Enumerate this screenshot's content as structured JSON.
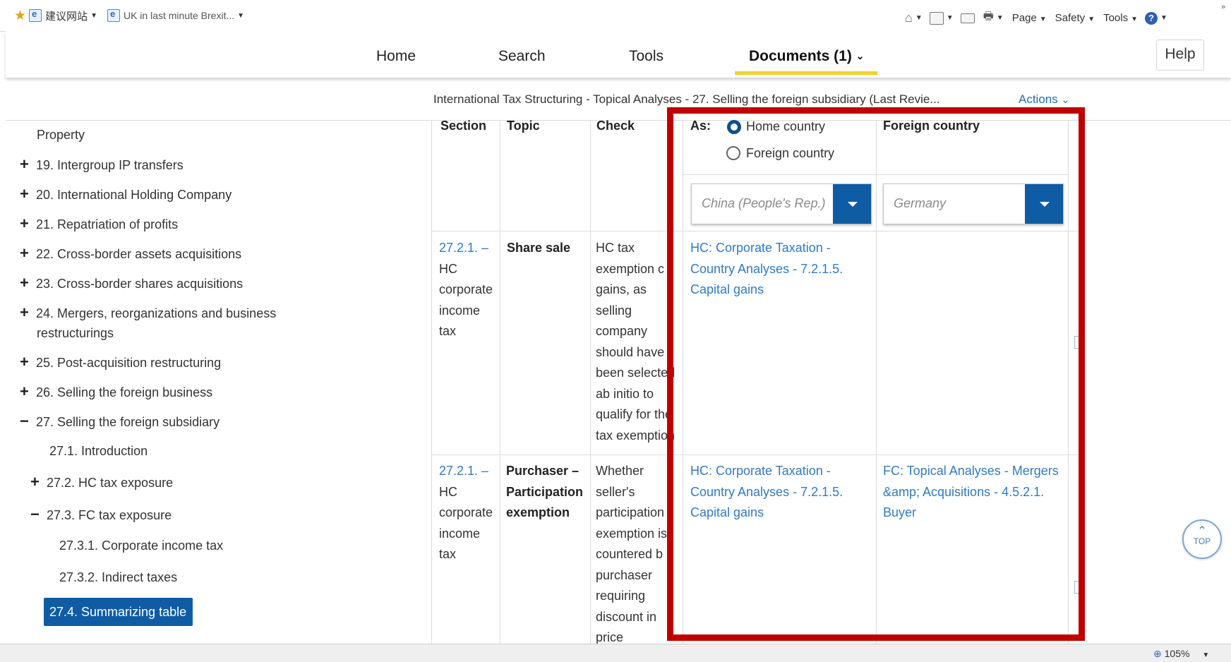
{
  "browser": {
    "favorites": {
      "suggested_sites": "建议网站",
      "tab_title": "UK in last minute Brexit..."
    },
    "command_bar": {
      "page": "Page",
      "safety": "Safety",
      "tools": "Tools"
    },
    "zoom": "105%"
  },
  "nav": {
    "home": "Home",
    "search": "Search",
    "tools": "Tools",
    "documents": "Documents (1)",
    "help": "Help"
  },
  "document": {
    "title": "International Tax Structuring - Topical Analyses - 27. Selling the foreign subsidiary (Last Revie...",
    "actions": "Actions"
  },
  "tree": {
    "items": [
      {
        "label": "Property"
      },
      {
        "marker": "+",
        "label": "19. Intergroup IP transfers"
      },
      {
        "marker": "+",
        "label": "20. International Holding Company"
      },
      {
        "marker": "+",
        "label": "21. Repatriation of profits"
      },
      {
        "marker": "+",
        "label": "22. Cross-border assets acquisitions"
      },
      {
        "marker": "+",
        "label": "23. Cross-border shares acquisitions"
      },
      {
        "marker": "+",
        "label": "24. Mergers, reorganizations and business",
        "label2": "restructurings"
      },
      {
        "marker": "+",
        "label": "25. Post-acquisition restructuring"
      },
      {
        "marker": "+",
        "label": "26. Selling the foreign business"
      },
      {
        "marker": "−",
        "label": "27. Selling the foreign subsidiary"
      },
      {
        "label": "27.1. Introduction"
      },
      {
        "marker": "+",
        "label": "27.2. HC tax exposure"
      },
      {
        "marker": "−",
        "label": "27.3. FC tax exposure"
      },
      {
        "label": "27.3.1. Corporate income tax"
      },
      {
        "label": "27.3.2. Indirect taxes"
      },
      {
        "label": "27.4. Summarizing table"
      }
    ]
  },
  "table": {
    "headers": {
      "section": "Section",
      "topic": "Topic",
      "check": "Check",
      "as": "As:",
      "foreign_country": "Foreign country"
    },
    "radio": {
      "home_country": "Home country",
      "foreign_country": "Foreign country",
      "selected": "Home country"
    },
    "selects": {
      "home_value": "China (People's Rep.)",
      "foreign_value": "Germany"
    },
    "rows": [
      {
        "section_link": "27.2.1. –",
        "section_rest": [
          "HC",
          "corporate",
          "income",
          "tax"
        ],
        "topic": "Share sale",
        "check_lines": [
          "HC tax",
          "exemption c",
          "gains, as",
          "selling",
          "company",
          "should have",
          "been selected",
          "ab initio to",
          "qualify for the",
          "tax exemption"
        ],
        "home_links": [
          "HC: Corporate Taxation -",
          "Country Analyses - 7.2.1.5.",
          "Capital gains"
        ],
        "foreign_links": []
      },
      {
        "section_link": "27.2.1. –",
        "section_rest": [
          "HC",
          "corporate",
          "income",
          "tax"
        ],
        "topic_lines": [
          "Purchaser –",
          "Participation",
          "exemption"
        ],
        "check_lines": [
          "Whether",
          "seller's",
          "participation",
          "exemption is",
          "countered b",
          "purchaser",
          "requiring",
          "discount in",
          "price"
        ],
        "home_links": [
          "HC: Corporate Taxation -",
          "Country Analyses - 7.2.1.5.",
          "Capital gains"
        ],
        "foreign_links": [
          "FC: Topical Analyses - Mergers",
          "&amp; Acquisitions - 4.5.2.1.",
          "Buyer"
        ]
      }
    ]
  },
  "top_button": "TOP",
  "colors": {
    "highlight_border": "#c00000",
    "accent_blue": "#0f5ca5",
    "link_blue": "#2e7bc4",
    "nav_underline": "#f6d02b"
  }
}
